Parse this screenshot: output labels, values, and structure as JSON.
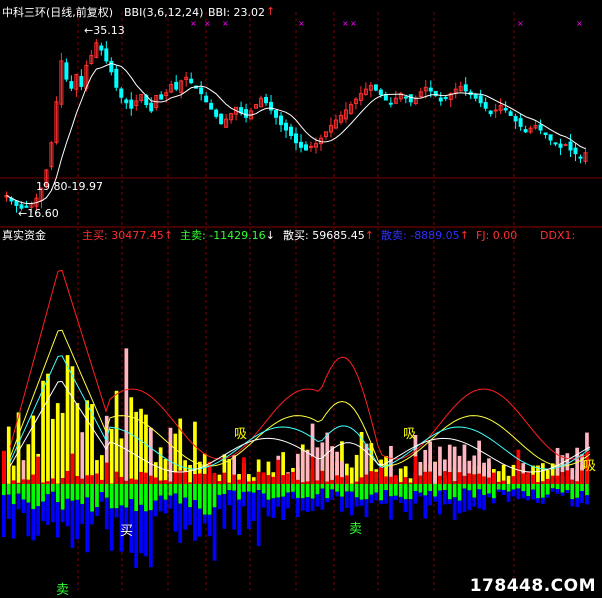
{
  "top_panel": {
    "title": "中科三环(日线,前复权)",
    "indicator_name": "BBI(3,6,12,24)",
    "indicator_value": "BBI: 23.02",
    "arrow": "↑",
    "price_high_label": "35.13",
    "price_low_label": "16.60",
    "range_label": "19.80-19.97"
  },
  "bottom_panel": {
    "title": "真实资金",
    "stats": [
      {
        "label": "主买:",
        "value": "30477.45",
        "arrow": "↑",
        "color": "#ff3030"
      },
      {
        "label": "主卖:",
        "value": "-11429.16",
        "arrow": "↓",
        "color": "#30ff30"
      },
      {
        "label": "散买:",
        "value": "59685.45",
        "arrow": "↑",
        "color": "#ffffff"
      },
      {
        "label": "散卖:",
        "value": "-8889.05",
        "arrow": "↑",
        "color": "#3030ff"
      },
      {
        "label": "FJ:",
        "value": "0.00",
        "arrow": "",
        "color": "#ff3030"
      },
      {
        "label": "DDX1:",
        "value": "",
        "arrow": "",
        "color": "#ff3030"
      }
    ],
    "annotations": [
      {
        "text": "吸",
        "color": "#ffff00"
      },
      {
        "text": "吸",
        "color": "#ffff00"
      },
      {
        "text": "吸",
        "color": "#ffff00"
      },
      {
        "text": "买",
        "color": "#ffffff"
      },
      {
        "text": "卖",
        "color": "#30ff30"
      },
      {
        "text": "卖",
        "color": "#30ff30"
      }
    ]
  },
  "watermark": "178448.COM",
  "colors": {
    "up": "#ff3030",
    "down": "#00ffff",
    "bbi": "#ffffff",
    "grid": "#8b0000",
    "buy_big": "#ff0000",
    "buy_retail": "#ffff00",
    "sell_big": "#00ff00",
    "sell_retail": "#0000ff",
    "pink": "#ffb6c1"
  },
  "chart_data": {
    "type": "candlestick",
    "series_close": [
      18.2,
      17.6,
      17.1,
      16.8,
      16.9,
      17.3,
      17.9,
      19.0,
      21.0,
      24.0,
      28.5,
      33.0,
      31.0,
      30.0,
      31.5,
      30.2,
      32.5,
      33.6,
      35.0,
      34.2,
      33.0,
      31.8,
      30.1,
      29.0,
      28.4,
      27.8,
      28.6,
      29.3,
      28.2,
      27.5,
      29.2,
      28.8,
      29.5,
      30.4,
      29.9,
      30.8,
      31.2,
      30.6,
      30.0,
      29.4,
      28.5,
      27.7,
      26.9,
      26.1,
      26.6,
      27.2,
      27.9,
      27.3,
      26.8,
      27.5,
      28.2,
      28.9,
      28.4,
      27.6,
      26.8,
      26.0,
      25.4,
      24.8,
      24.0,
      23.5,
      23.2,
      23.6,
      23.9,
      24.5,
      25.2,
      25.9,
      26.5,
      27.0,
      27.6,
      28.2,
      28.8,
      29.4,
      29.9,
      30.3,
      29.8,
      29.3,
      28.7,
      28.3,
      28.9,
      29.4,
      29.0,
      28.5,
      28.9,
      29.6,
      30.1,
      29.7,
      29.2,
      28.6,
      28.9,
      29.4,
      29.9,
      30.2,
      29.7,
      29.3,
      28.9,
      28.4,
      27.8,
      27.2,
      27.6,
      28.1,
      27.6,
      27.0,
      26.4,
      25.8,
      25.2,
      25.6,
      25.9,
      25.4,
      24.9,
      24.3,
      23.9,
      23.5,
      23.8,
      23.2,
      22.8,
      22.3,
      22.9
    ],
    "ylim_price": [
      15.5,
      37.5
    ]
  }
}
